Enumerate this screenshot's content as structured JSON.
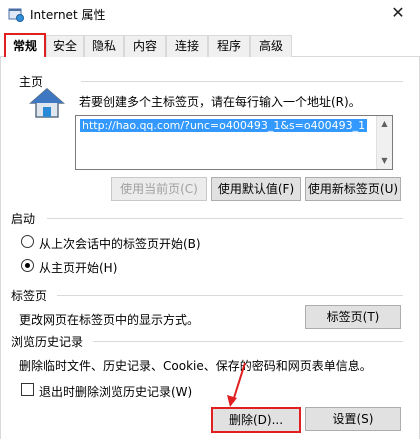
{
  "window": {
    "title": "Internet 属性",
    "close_glyph": "✕"
  },
  "tabs": [
    {
      "label": "常规",
      "active": true
    },
    {
      "label": "安全"
    },
    {
      "label": "隐私"
    },
    {
      "label": "内容"
    },
    {
      "label": "连接"
    },
    {
      "label": "程序"
    },
    {
      "label": "高级"
    }
  ],
  "home": {
    "section_label": "主页",
    "description": "若要创建多个主标签页，请在每行输入一个地址(R)。",
    "url": "http://hao.qq.com/?unc=o400493_1&s=o400493_1",
    "buttons": {
      "use_current": "使用当前页(C)",
      "use_default": "使用默认值(F)",
      "use_new_tab": "使用新标签页(U)"
    }
  },
  "startup": {
    "section_label": "启动",
    "options": [
      {
        "label": "从上次会话中的标签页开始(B)",
        "selected": false
      },
      {
        "label": "从主页开始(H)",
        "selected": true
      }
    ]
  },
  "tabs_section": {
    "section_label": "标签页",
    "description": "更改网页在标签页中的显示方式。",
    "button": "标签页(T)"
  },
  "history": {
    "section_label": "浏览历史记录",
    "description": "删除临时文件、历史记录、Cookie、保存的密码和网页表单信息。",
    "checkbox_label": "退出时删除浏览历史记录(W)",
    "delete_button": "删除(D)...",
    "settings_button": "设置(S)"
  },
  "colors": {
    "annotation": "#e02020",
    "selection": "#3399ff"
  }
}
